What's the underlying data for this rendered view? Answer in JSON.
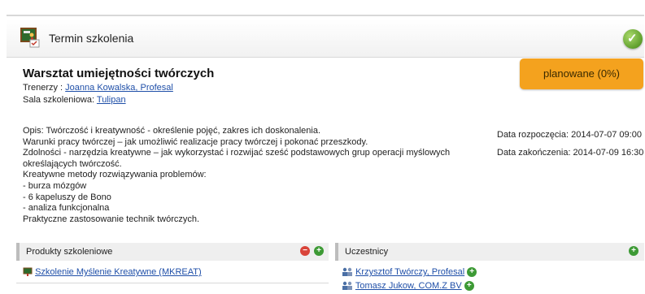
{
  "header": {
    "title": "Termin szkolenia",
    "ok_icon": "check-circle-icon"
  },
  "workshop": {
    "title": "Warsztat umiejętności twórczych",
    "trainers_label": "Trenerzy :",
    "trainers_value": "Joanna Kowalska, Profesal",
    "room_label": "Sala szkoleniowa:",
    "room_value": "Tulipan",
    "status": "planowane (0%)",
    "status_color": "#f4a21e"
  },
  "description": [
    "Opis: Twórczość i kreatywność - określenie pojęć, zakres ich doskonalenia.",
    "Warunki pracy twórczej – jak umożliwić realizacje pracy twórczej i pokonać przeszkody.",
    "Zdolności - narzędzia kreatywne – jak wykorzystać i rozwijać sześć podstawowych grup operacji myślowych",
    "określających twórczość.",
    "Kreatywne metody rozwiązywania problemów:",
    "- burza mózgów",
    "- 6 kapeluszy de Bono",
    "- analiza funkcjonalna",
    "Praktyczne zastosowanie technik twórczych."
  ],
  "dates": {
    "start": "Data rozpoczęcia: 2014-07-07 09:00",
    "end": "Data zakończenia: 2014-07-09 16:30"
  },
  "products_panel": {
    "title": "Produkty szkoleniowe",
    "items": [
      "Szkolenie Myślenie Kreatywne (MKREAT)"
    ]
  },
  "participants_panel": {
    "title": "Uczestnicy",
    "items": [
      "Krzysztof Twórczy, Profesal",
      "Tomasz Jukow, COM.Z BV"
    ]
  }
}
